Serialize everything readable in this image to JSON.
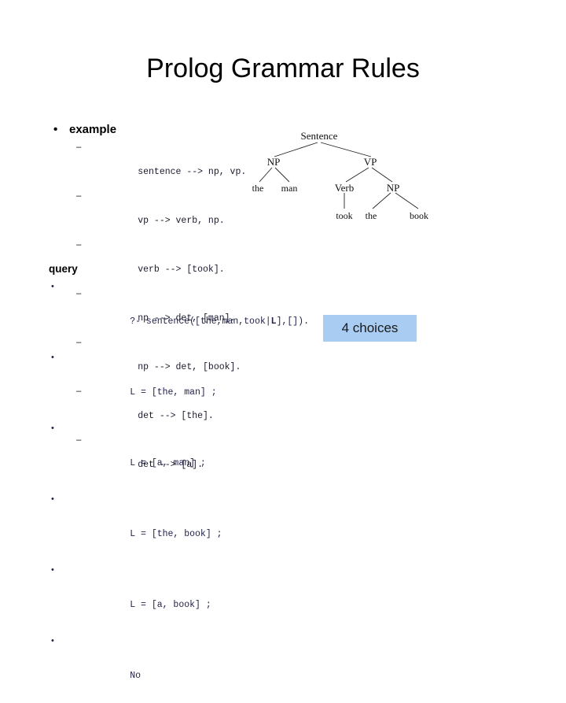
{
  "slide": {
    "title": "Prolog Grammar Rules",
    "background_color": "#ffffff"
  },
  "example_section": {
    "heading": "example",
    "bullet_glyph": "•",
    "sub_bullet_glyph": "–",
    "rules": [
      "sentence --> np, vp.",
      "vp --> verb, np.",
      "verb --> [took].",
      "np --> det, [man].",
      "np --> det, [book].",
      "det --> [the].",
      "det --> [a]."
    ]
  },
  "query_section": {
    "heading": "query",
    "bullet_glyph": "•",
    "lines": [
      {
        "pre": "?- sentence([the,man,took|",
        "bold": "L",
        "post": "],[]).",
        "text": "?- sentence([the,man,took|L],[])."
      },
      {
        "text": "L = [the, man] ;"
      },
      {
        "text": "L = [a, man] ;"
      },
      {
        "text": "L = [the, book] ;"
      },
      {
        "text": "L = [a, book] ;"
      },
      {
        "text": "No"
      }
    ]
  },
  "callout": {
    "label": "4 choices",
    "background_color": "#a8ccf2",
    "text_color": "#1a1a1a"
  },
  "parse_tree": {
    "nodes": {
      "root": "Sentence",
      "np_left": "NP",
      "vp": "VP",
      "the_left": "the",
      "man": "man",
      "verb": "Verb",
      "np_right": "NP",
      "took": "took",
      "the_right": "the",
      "book": "book"
    }
  }
}
